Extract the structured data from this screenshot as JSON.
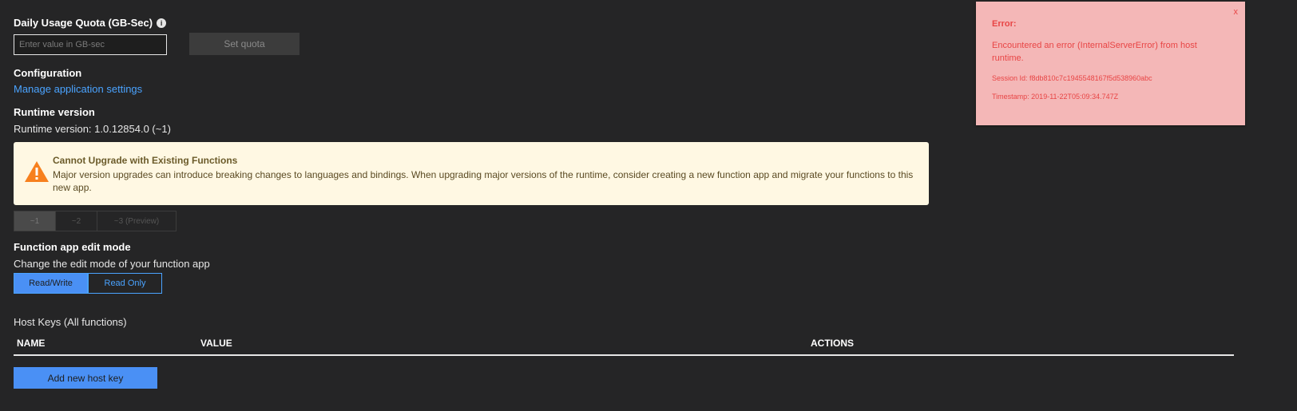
{
  "quota": {
    "label": "Daily Usage Quota (GB-Sec)",
    "info_icon": "i",
    "input_placeholder": "Enter value in GB-sec",
    "input_value": "",
    "set_button": "Set quota"
  },
  "configuration": {
    "heading": "Configuration",
    "link": "Manage application settings"
  },
  "runtime": {
    "heading": "Runtime version",
    "current": "Runtime version: 1.0.12854.0 (~1)",
    "warning": {
      "title": "Cannot Upgrade with Existing Functions",
      "body": "Major version upgrades can introduce breaking changes to languages and bindings. When upgrading major versions of the runtime, consider creating a new function app and migrate your functions to this new app."
    },
    "versions": [
      {
        "label": "~1",
        "active": true
      },
      {
        "label": "~2",
        "active": false
      },
      {
        "label": "~3 (Preview)",
        "active": false
      }
    ]
  },
  "edit_mode": {
    "heading": "Function app edit mode",
    "description": "Change the edit mode of your function app",
    "options": [
      "Read/Write",
      "Read Only"
    ],
    "selected": "Read/Write"
  },
  "host_keys": {
    "title": "Host Keys (All functions)",
    "columns": [
      "NAME",
      "VALUE",
      "ACTIONS"
    ],
    "add_button": "Add new host key"
  },
  "error_toast": {
    "close": "x",
    "title": "Error:",
    "message": "Encountered an error (InternalServerError) from host runtime.",
    "session": "Session Id: f8db810c7c1945548167f5d538960abc",
    "timestamp": "Timestamp: 2019-11-22T05:09:34.747Z"
  },
  "colors": {
    "background": "#252526",
    "accent": "#4a90f5",
    "warning_bg": "#fff8e3",
    "warning_icon": "#f7801e",
    "error_bg": "#f4b7b7",
    "error_text": "#e84545"
  }
}
